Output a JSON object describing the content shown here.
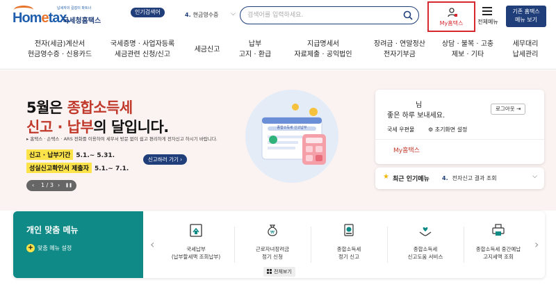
{
  "header": {
    "logo_tagline": "납세자의 길잡이 파트너",
    "logo_main_pre": "Hom",
    "logo_main_e": "e",
    "logo_main_post": "tax.",
    "logo_sub": "국세청홈택스",
    "popular_badge": "인기검색어",
    "popular_rank": "4.",
    "popular_term": "현금영수증",
    "search_placeholder": "검색어를 입력하세요.",
    "my_home_label": "My홈택스",
    "all_menu_label": "전체메뉴",
    "old_button_line1": "기존 홈택스",
    "old_button_line2": "메뉴 보기"
  },
  "nav": {
    "items": [
      {
        "line1": "전자(세금)계산서",
        "line2": "현금영수증 · 신용카드"
      },
      {
        "line1": "국세증명 · 사업자등록",
        "line2": "세금관련 신청/신고"
      },
      {
        "line1": "세금신고",
        "line2": ""
      },
      {
        "line1": "납부",
        "line2": "고지 · 환급"
      },
      {
        "line1": "지급명세서",
        "line2": "자료제출 · 공익법인"
      },
      {
        "line1": "장려금 · 연말정산",
        "line2": "전자기부금"
      },
      {
        "line1": "상담 · 불복 · 고충",
        "line2": "제보 · 기타"
      },
      {
        "line1": "세무대리",
        "line2": "납세관리"
      }
    ]
  },
  "hero": {
    "title_l1_pre": "5월은 ",
    "title_l1_hl": "종합소득세",
    "title_l2_hl": "신고 · 납부",
    "title_l2_post": "의 달입니다.",
    "desc": "▸ 홈택스 · 손택스 · ARS 전화를 이용하여 세무서 방문 없이 쉽고 편리하게 전자신고 하시기 바랍니다.",
    "period1_tag": "신고 · 납부기간",
    "period1_val": "5.1.~ 5.31.",
    "period2_tag": "성실신고확인서 제출자",
    "period2_val": "5.1.~ 7.1.",
    "report_button": "신고하러 가기 ›",
    "pager_prev": "‹",
    "pager_text": "1 / 3",
    "pager_next": "›",
    "pager_pause": "❚❚",
    "illus_caption": "종합소득세 신고납부"
  },
  "login_card": {
    "name": "님",
    "greeting": "좋은 하루 보내세요.",
    "logout": "로그아웃",
    "link_mailbox": "국세 우편물",
    "link_reset": "⚙ 초기화면 설정",
    "my_home": "My홈택스"
  },
  "recent": {
    "title": "최근 인기메뉴",
    "rank": "4.",
    "item": "전자신고 결과 조회"
  },
  "custom_menu": {
    "title": "개인 맞춤 메뉴",
    "setting": "맞춤 메뉴 설정",
    "items": [
      {
        "icon": "tax-payment-icon",
        "line1": "국세납부",
        "line2": "(납부할세액 조회납부)"
      },
      {
        "icon": "money-bag-icon",
        "line1": "근로자녀장려금",
        "line2": "정기 신청"
      },
      {
        "icon": "document-money-icon",
        "line1": "종합소득세",
        "line2": "정기 신고"
      },
      {
        "icon": "heart-hands-icon",
        "line1": "종합소득세",
        "line2": "신고도움 서비스"
      },
      {
        "icon": "printer-icon",
        "line1": "종합소득세 중간예납",
        "line2": "고지세액 조회"
      }
    ],
    "view_all": "전체보기"
  },
  "colors": {
    "brand": "#1f3e7a",
    "accent_red": "#d6272e",
    "teal": "#0f8a86",
    "highlight_yellow": "#fde34a"
  }
}
